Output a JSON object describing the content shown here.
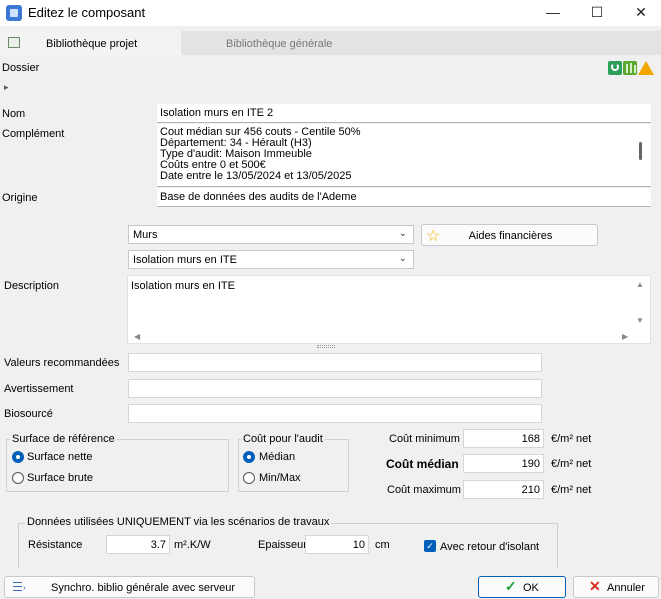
{
  "window": {
    "title": "Editez le composant",
    "minimize": "—",
    "maximize": "☐",
    "close": "✕"
  },
  "tabs": [
    {
      "label": "Bibliothèque projet",
      "active": true
    },
    {
      "label": "Bibliothèque générale",
      "active": false
    }
  ],
  "dossier": {
    "label": "Dossier",
    "expand": "▸",
    "icons": [
      "recycle-icon",
      "forest-icon",
      "energy-label-icon"
    ]
  },
  "fields": {
    "nom_label": "Nom",
    "nom_value": "Isolation murs en ITE 2",
    "complement_label": "Complément",
    "complement_lines": [
      "Cout médian sur 456 couts - Centile 50%",
      "Département: 34 - Hérault (H3)",
      "Type d'audit: Maison Immeuble",
      "Coûts entre 0 et 500€",
      "Date entre le 13/05/2024 et 13/05/2025"
    ],
    "origine_label": "Origine",
    "origine_value": "Base de données des audits de l'Ademe"
  },
  "category": {
    "combo1": "Murs",
    "combo2": "Isolation murs en ITE",
    "aides_button": "Aides financières"
  },
  "description": {
    "label": "Description",
    "value": "Isolation murs en ITE"
  },
  "extra_fields": [
    {
      "label": "Valeurs recommandées",
      "value": ""
    },
    {
      "label": "Avertissement",
      "value": ""
    },
    {
      "label": "Biosourcé",
      "value": ""
    }
  ],
  "surface_ref": {
    "title": "Surface de référence",
    "options": [
      {
        "label": "Surface nette",
        "selected": true
      },
      {
        "label": "Surface brute",
        "selected": false
      }
    ]
  },
  "cout_audit": {
    "title": "Coût pour l'audit",
    "options": [
      {
        "label": "Médian",
        "selected": true
      },
      {
        "label": "Min/Max",
        "selected": false
      }
    ]
  },
  "costs": [
    {
      "label": "Coût minimum",
      "value": "168",
      "unit": "€/m² net",
      "bold": false
    },
    {
      "label": "Coût médian",
      "value": "190",
      "unit": "€/m² net",
      "bold": true
    },
    {
      "label": "Coût maximum",
      "value": "210",
      "unit": "€/m² net",
      "bold": false
    }
  ],
  "scenarios": {
    "title": "Données utilisées UNIQUEMENT via les scénarios de travaux",
    "resistance_label": "Résistance",
    "resistance_value": "3.7",
    "resistance_unit": "m².K/W",
    "epaisseur_label": "Epaisseur",
    "epaisseur_value": "10",
    "epaisseur_unit": "cm",
    "retour_label": "Avec retour d'isolant",
    "retour_checked": true
  },
  "footer": {
    "sync_button": "Synchro. biblio générale avec serveur",
    "ok_button": "OK",
    "cancel_button": "Annuler"
  },
  "colors": {
    "accent": "#005fb8",
    "ok_check": "#1e9e3a",
    "cancel_x": "#d52b1e",
    "star": "#e8b800"
  }
}
